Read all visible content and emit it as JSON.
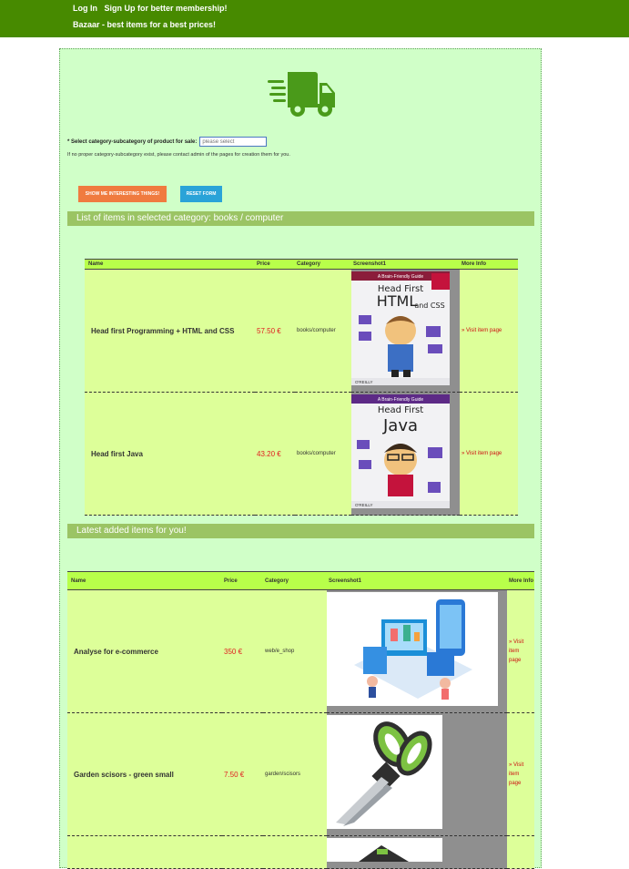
{
  "header": {
    "login": "Log In",
    "signup": "Sign Up for better membership!",
    "tagline": "Bazaar - best items for a best prices!"
  },
  "form": {
    "select_label": "* Select category-subcategory of product for sale:",
    "select_placeholder": "please select",
    "note": "If no proper category-subcategory exist, please contact admin of the pages for creation them for you.",
    "show_button": "SHOW ME INTERESTING THINGS!",
    "reset_button": "RESET FORM"
  },
  "category_section": {
    "heading": "List of items in selected category: books / computer",
    "columns": [
      "Name",
      "Price",
      "Category",
      "Screenshot1",
      "More Info"
    ],
    "rows": [
      {
        "name": "Head first Programming + HTML and CSS",
        "price": "57.50 €",
        "category": "books/computer",
        "info": "» Visit item page",
        "cover_header": "A Brain-Friendly Guide",
        "cover_title_1": "Head First",
        "cover_title_2": "HTML",
        "cover_title_3": "and CSS",
        "cover_footer": "O'REILLY"
      },
      {
        "name": "Head first Java",
        "price": "43.20 €",
        "category": "books/computer",
        "info": "» Visit item page",
        "cover_header": "A Brain-Friendly Guide",
        "cover_title_1": "Head First",
        "cover_title_2": "Java",
        "cover_footer": "O'REILLY"
      }
    ]
  },
  "latest_section": {
    "heading": "Latest added items for you!",
    "columns": [
      "Name",
      "Price",
      "Category",
      "Screenshot1",
      "More Info"
    ],
    "rows": [
      {
        "name": "Analyse for e-commerce",
        "price": "350 €",
        "category": "web/e_shop",
        "info_1": "» Visit",
        "info_2": "item",
        "info_3": "page"
      },
      {
        "name": "Garden scisors - green small",
        "price": "7.50 €",
        "category": "garden/scisors",
        "info_1": "» Visit",
        "info_2": "item",
        "info_3": "page"
      }
    ]
  },
  "colors": {
    "topbar": "#478a00",
    "page_bg": "#d0ffc8",
    "section": "#9bc464",
    "header_row": "#b8ff4a",
    "row": "#ddff99",
    "price": "#e02020",
    "truck": "#4a9a1a"
  },
  "icons": [
    "delivery-truck-icon"
  ]
}
